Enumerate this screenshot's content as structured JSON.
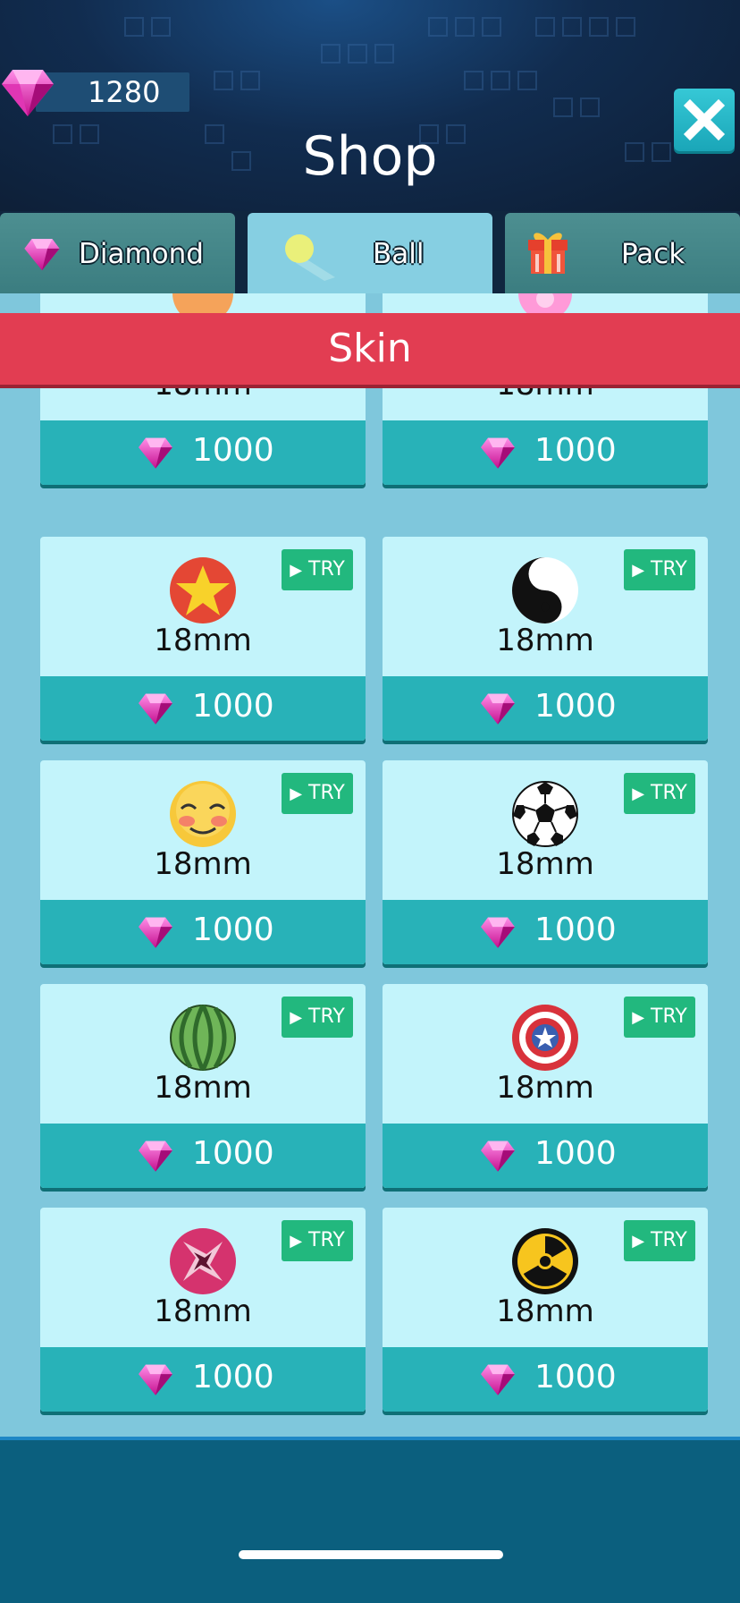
{
  "header": {
    "diamond_count": "1280",
    "title": "Shop",
    "close_icon": "close-icon"
  },
  "tabs": [
    {
      "label": "Diamond",
      "icon": "diamond-icon",
      "active": false
    },
    {
      "label": "Ball",
      "icon": "ball-icon",
      "active": true
    },
    {
      "label": "Pack",
      "icon": "gift-icon",
      "active": false
    }
  ],
  "section": {
    "title": "Skin"
  },
  "try_label": "TRY",
  "items": [
    {
      "size": "18mm",
      "price": "1000",
      "ball": "orange-ball",
      "try": false
    },
    {
      "size": "18mm",
      "price": "1000",
      "ball": "pink-ball",
      "try": false
    },
    {
      "size": "18mm",
      "price": "1000",
      "ball": "star-ball",
      "try": true
    },
    {
      "size": "18mm",
      "price": "1000",
      "ball": "yin-yang-ball",
      "try": true
    },
    {
      "size": "18mm",
      "price": "1000",
      "ball": "emoji-ball",
      "try": true
    },
    {
      "size": "18mm",
      "price": "1000",
      "ball": "soccer-ball",
      "try": true
    },
    {
      "size": "18mm",
      "price": "1000",
      "ball": "watermelon-ball",
      "try": true
    },
    {
      "size": "18mm",
      "price": "1000",
      "ball": "shield-ball",
      "try": true
    },
    {
      "size": "18mm",
      "price": "1000",
      "ball": "shuriken-ball",
      "try": true
    },
    {
      "size": "18mm",
      "price": "1000",
      "ball": "radiation-ball",
      "try": true
    }
  ],
  "colors": {
    "banner": "#e23d52",
    "card": "#c3f4fb",
    "price_bar": "#28b2b8",
    "try_button": "#22b87e"
  }
}
